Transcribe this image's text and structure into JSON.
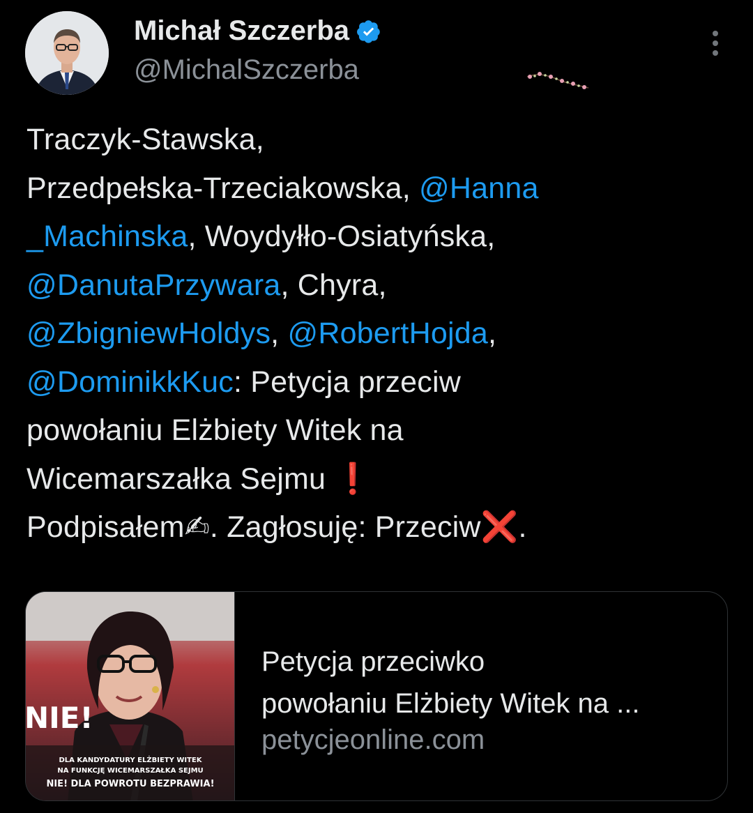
{
  "author": {
    "display_name": "Michał Szczerba",
    "handle": "@MichalSzczerba",
    "verified": true,
    "avatar": "profile-photo"
  },
  "tweet": {
    "lines": [
      [
        {
          "t": "Traczyk-Stawska,",
          "m": false
        }
      ],
      [
        {
          "t": "Przedpełska-Trzeciakowska, ",
          "m": false
        },
        {
          "t": "@Hanna",
          "m": true
        }
      ],
      [
        {
          "t": "_Machinska",
          "m": true
        },
        {
          "t": ", Woydyłło-Osiatyńska,",
          "m": false
        }
      ],
      [
        {
          "t": "@DanutaPrzywara",
          "m": true
        },
        {
          "t": ", Chyra,",
          "m": false
        }
      ],
      [
        {
          "t": "@ZbigniewHoldys",
          "m": true
        },
        {
          "t": ", ",
          "m": false
        },
        {
          "t": "@RobertHojda",
          "m": true
        },
        {
          "t": ",",
          "m": false
        }
      ],
      [
        {
          "t": "@DominikkKuc",
          "m": true
        },
        {
          "t": ": Petycja przeciw",
          "m": false
        }
      ],
      [
        {
          "t": "powołaniu Elżbiety Witek na",
          "m": false
        }
      ],
      [
        {
          "t": "Wicemarszałka Sejmu ",
          "m": false
        },
        {
          "t": "❗",
          "e": "exclamation"
        }
      ],
      [
        {
          "t": "Podpisałem",
          "m": false
        },
        {
          "t": "✍",
          "e": "writing-hand"
        },
        {
          "t": ". Zagłosuję: Przeciw",
          "m": false
        },
        {
          "t": "❌",
          "e": "cross-mark"
        },
        {
          "t": ".",
          "m": false
        }
      ]
    ]
  },
  "link_card": {
    "title_line1": "Petycja przeciwko",
    "title_line2": "powołaniu Elżbiety Witek na ...",
    "domain": "petycjeonline.com",
    "image": {
      "big_text": "NIE!",
      "caption_line1": "DLA KANDYDATURY ELŻBIETY WITEK",
      "caption_line2": "NA FUNKCJĘ WICEMARSZAŁKA SEJMU",
      "caption_line3": "NIE! DLA POWROTU BEZPRAWIA!"
    }
  },
  "icons": {
    "verified": "verified-badge-icon",
    "more": "more-options-icon"
  },
  "colors": {
    "background": "#000000",
    "text": "#e7e9ea",
    "secondary": "#8b9198",
    "mention": "#1d9bf0",
    "border": "#2f3336",
    "verified": "#1d9bf0",
    "emoji_red": "#e0243a"
  }
}
